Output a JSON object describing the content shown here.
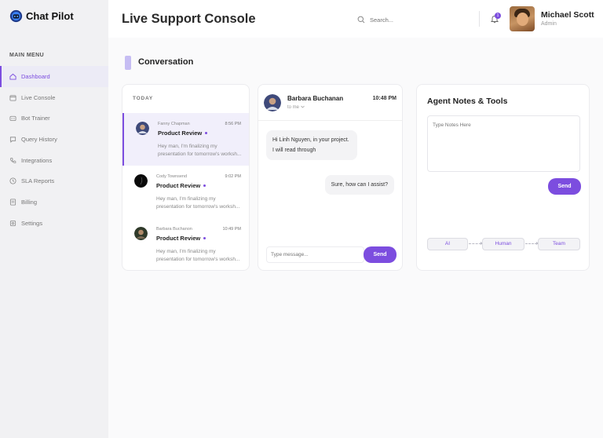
{
  "app": {
    "name": "Chat Pilot"
  },
  "sidebar": {
    "menu_title": "MAIN MENU",
    "items": [
      {
        "label": "Dashboard",
        "icon": "home-icon",
        "active": true
      },
      {
        "label": "Live Console",
        "icon": "calendar-icon",
        "active": false
      },
      {
        "label": "Bot Trainer",
        "icon": "bot-icon",
        "active": false
      },
      {
        "label": "Query History",
        "icon": "chat-icon",
        "active": false
      },
      {
        "label": "Integrations",
        "icon": "phone-icon",
        "active": false
      },
      {
        "label": "SLA Reports",
        "icon": "clock-icon",
        "active": false
      },
      {
        "label": "Billing",
        "icon": "billing-icon",
        "active": false
      },
      {
        "label": "Settings",
        "icon": "settings-icon",
        "active": false
      }
    ]
  },
  "header": {
    "title": "Live Support Console",
    "search_placeholder": "Search...",
    "notification_count": "1",
    "user": {
      "name": "Michael Scott",
      "role": "Admin"
    }
  },
  "conversation": {
    "title": "Conversation",
    "list_heading": "TODAY",
    "chats": [
      {
        "name": "Fanny Chapman",
        "time": "8:56 PM",
        "subject": "Product Review",
        "preview": "Hey man, I'm finalizing my presentation for tomorrow's worksh...",
        "active": true
      },
      {
        "name": "Cody Townsend",
        "time": "9:02 PM",
        "subject": "Product Review",
        "preview": "Hey man, I'm finalizing my presentation for tomorrow's worksh...",
        "active": false
      },
      {
        "name": "Barbara Buchanon",
        "time": "10:49 PM",
        "subject": "Product Review",
        "preview": "Hey man, I'm finalizing my presentation for tomorrow's worksh...",
        "active": false
      }
    ],
    "open_chat": {
      "name": "Barbara Buchanan",
      "sub": "to me",
      "time": "10:48 PM",
      "messages": [
        {
          "text": "Hi Linh Nguyen, in your project. I will read through",
          "from": "them"
        },
        {
          "text": "Sure, how can I assist?",
          "from": "me"
        }
      ],
      "input_placeholder": "Type message...",
      "send_label": "Send"
    }
  },
  "notes": {
    "title": "Agent Notes & Tools",
    "placeholder": "Type Notes Here",
    "send_label": "Send",
    "flow": [
      "AI",
      "Human",
      "Team"
    ]
  },
  "colors": {
    "accent": "#7c4ddf",
    "sidebar_bg": "#f1f1f3",
    "active_bg": "#ecebf6"
  }
}
